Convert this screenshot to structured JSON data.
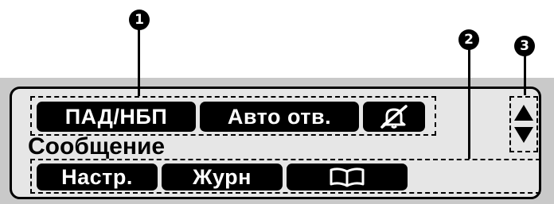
{
  "callouts": [
    "1",
    "2",
    "3"
  ],
  "top_row": {
    "buttons": [
      {
        "label": "ПАД/НБП"
      },
      {
        "label": "Авто отв."
      },
      {
        "icon": "bell-muted-icon"
      }
    ]
  },
  "message": "Сообщение",
  "bottom_row": {
    "buttons": [
      {
        "label": "Настр."
      },
      {
        "label": "Журн"
      },
      {
        "icon": "book-icon"
      }
    ]
  },
  "scroll": {
    "icon": "up-down-arrows-icon"
  }
}
